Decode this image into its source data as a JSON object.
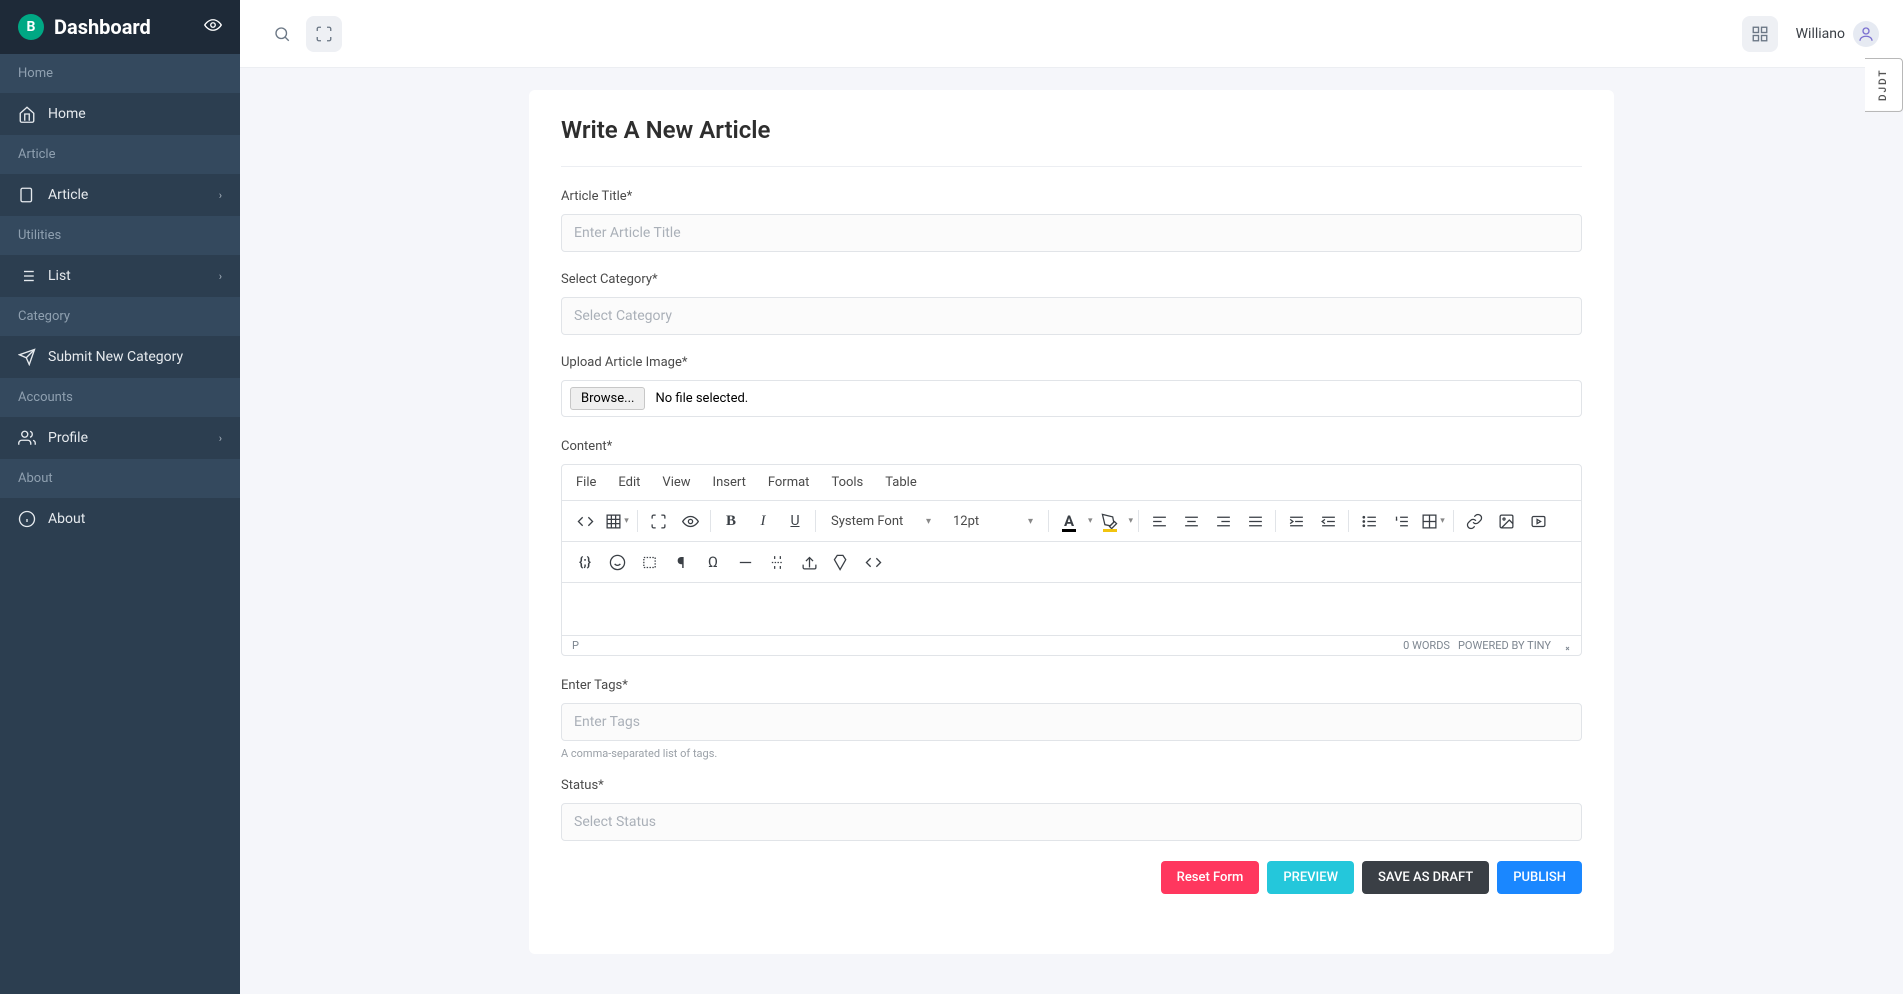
{
  "brand": {
    "initial": "B",
    "title": "Dashboard"
  },
  "sidebar": {
    "sections": [
      {
        "label": "Home",
        "items": [
          {
            "name": "home",
            "label": "Home",
            "expandable": false
          }
        ]
      },
      {
        "label": "Article",
        "items": [
          {
            "name": "article",
            "label": "Article",
            "expandable": true
          }
        ]
      },
      {
        "label": "Utilities",
        "items": [
          {
            "name": "list",
            "label": "List",
            "expandable": true
          }
        ]
      },
      {
        "label": "Category",
        "items": [
          {
            "name": "submit-category",
            "label": "Submit New Category",
            "expandable": false
          }
        ]
      },
      {
        "label": "Accounts",
        "items": [
          {
            "name": "profile",
            "label": "Profile",
            "expandable": true
          }
        ]
      },
      {
        "label": "About",
        "items": [
          {
            "name": "about",
            "label": "About",
            "expandable": false
          }
        ]
      }
    ]
  },
  "topbar": {
    "user_name": "Williano"
  },
  "page": {
    "title": "Write A New Article",
    "labels": {
      "article_title": "Article Title*",
      "select_category": "Select Category*",
      "upload_image": "Upload Article Image*",
      "content": "Content*",
      "enter_tags": "Enter Tags*",
      "status": "Status*"
    },
    "placeholders": {
      "article_title": "Enter Article Title",
      "select_category": "Select Category",
      "enter_tags": "Enter Tags",
      "select_status": "Select Status"
    },
    "file": {
      "browse": "Browse...",
      "no_file": "No file selected."
    },
    "tags_help": "A comma-separated list of tags.",
    "buttons": {
      "reset": "Reset Form",
      "preview": "PREVIEW",
      "save_draft": "SAVE AS DRAFT",
      "publish": "PUBLISH"
    }
  },
  "editor": {
    "menus": [
      "File",
      "Edit",
      "View",
      "Insert",
      "Format",
      "Tools",
      "Table"
    ],
    "font_family": "System Font",
    "font_size": "12pt",
    "status_path": "P",
    "word_count": "0 WORDS",
    "powered": "POWERED BY TINY"
  },
  "djdt": "DJDT"
}
